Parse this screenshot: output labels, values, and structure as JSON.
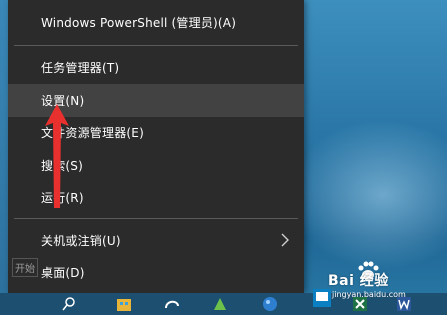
{
  "menu": {
    "items": [
      {
        "id": "powershell",
        "label": "Windows PowerShell (管理员)(A)"
      },
      {
        "id": "task-manager",
        "label": "任务管理器(T)"
      },
      {
        "id": "settings",
        "label": "设置(N)"
      },
      {
        "id": "file-explorer",
        "label": "文件资源管理器(E)"
      },
      {
        "id": "search",
        "label": "搜索(S)"
      },
      {
        "id": "run",
        "label": "运行(R)"
      },
      {
        "id": "shutdown",
        "label": "关机或注销(U)"
      },
      {
        "id": "desktop",
        "label": "桌面(D)"
      }
    ],
    "hovered": "settings",
    "start_tooltip": "开始"
  },
  "watermark": {
    "brand": "Bai  经验",
    "url": "jingyan.baidu.com"
  },
  "colors": {
    "menu_bg": "#2b2b2b",
    "menu_hover": "#424242",
    "arrow": "#e8302e"
  }
}
